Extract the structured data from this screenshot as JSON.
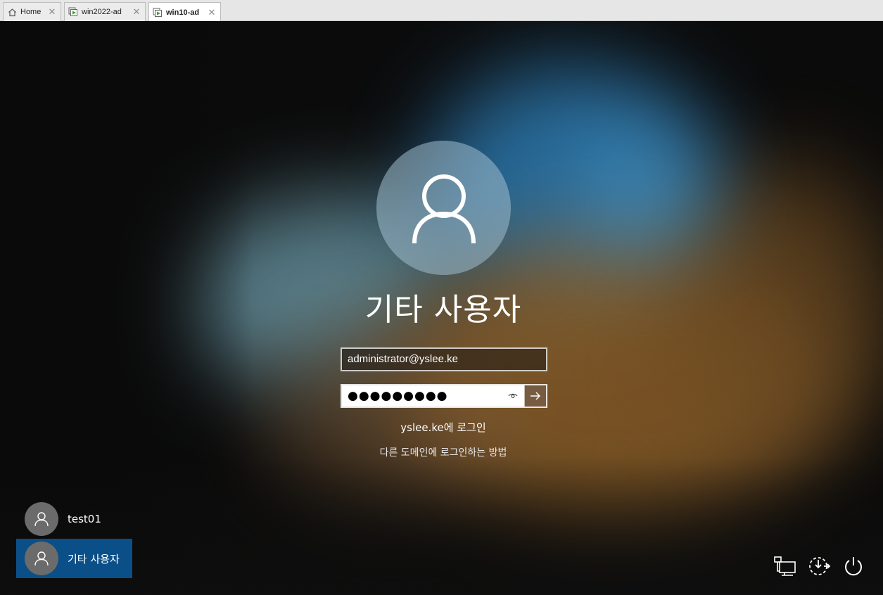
{
  "tabs": [
    {
      "label": "Home",
      "icon": "home-icon",
      "active": false
    },
    {
      "label": "win2022-ad",
      "icon": "vm-icon",
      "active": false
    },
    {
      "label": "win10-ad",
      "icon": "vm-icon",
      "active": true
    }
  ],
  "login": {
    "user_display_name": "기타 사용자",
    "username_value": "administrator@yslee.ke",
    "password_mask": "●●●●●●●●●",
    "signin_domain_text": "yslee.ke에 로그인",
    "other_domain_link": "다른 도메인에 로그인하는 방법"
  },
  "user_list": [
    {
      "name": "test01",
      "selected": false
    },
    {
      "name": "기타 사용자",
      "selected": true
    }
  ],
  "system_icons": [
    "network-icon",
    "ease-of-access-icon",
    "power-icon"
  ],
  "colors": {
    "selected_user_bg": "#0b4f88",
    "tabbar_bg": "#e6e6e6",
    "vm_icon_green": "#3aa520"
  }
}
